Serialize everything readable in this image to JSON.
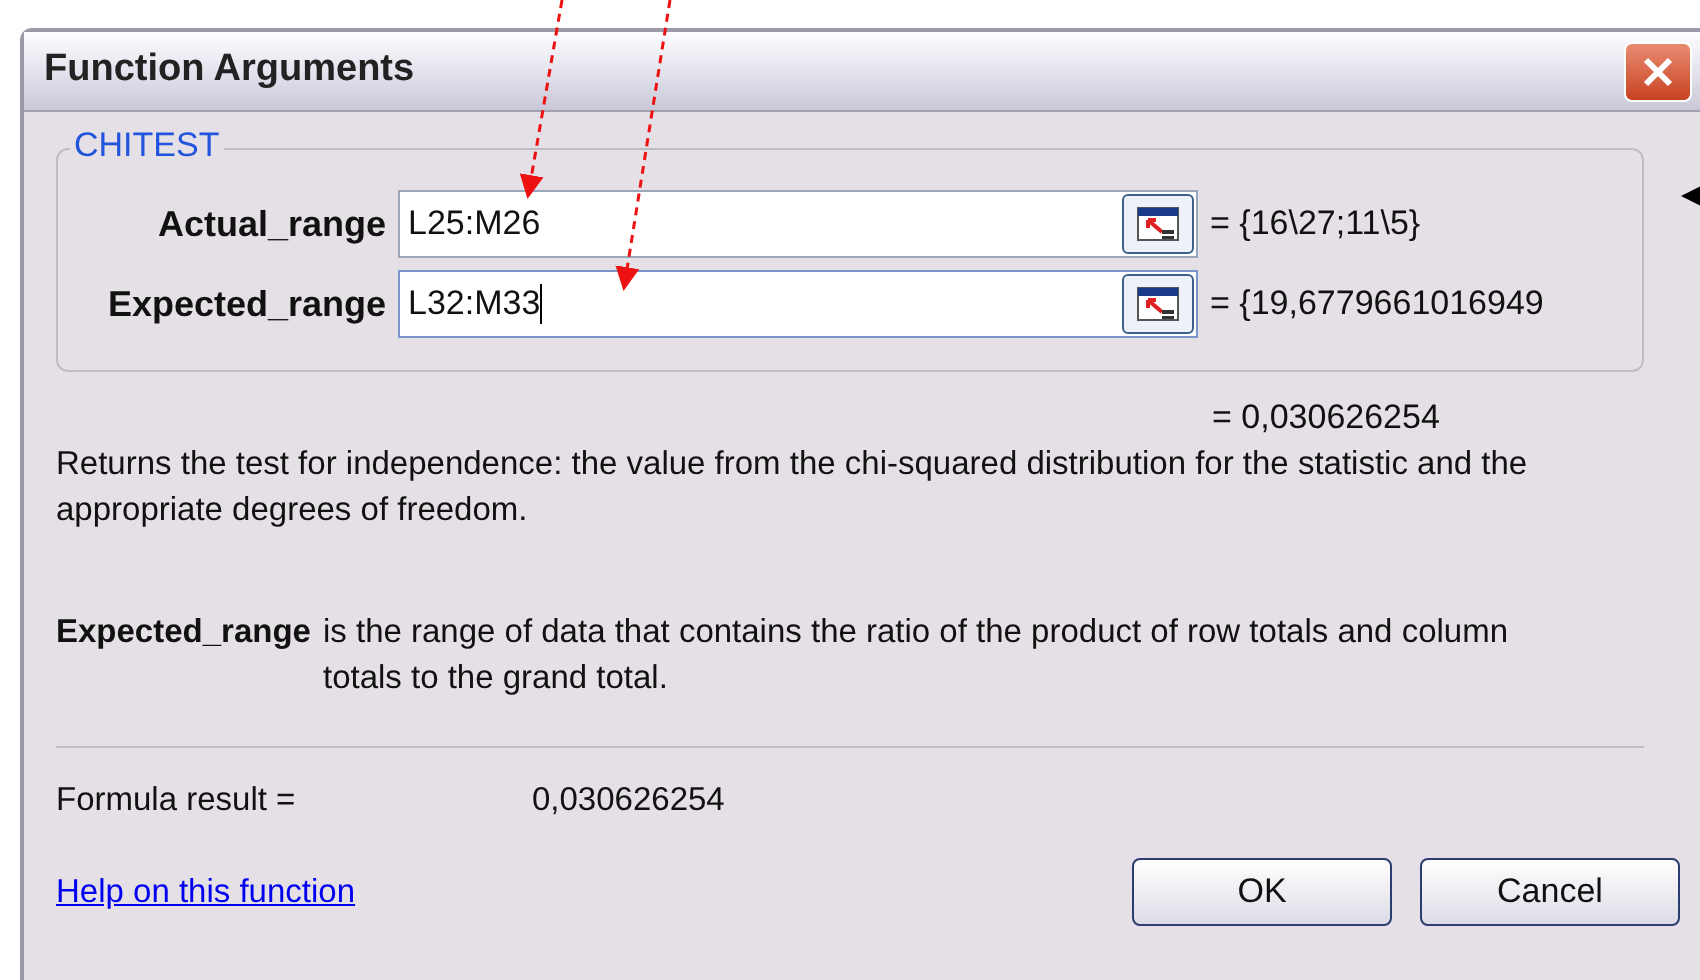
{
  "window": {
    "title": "Function Arguments"
  },
  "function_group": {
    "name": "CHITEST",
    "arguments": [
      {
        "label": "Actual_range",
        "value": "L25:M26",
        "focused": false,
        "result": "= {16\\27;11\\5}"
      },
      {
        "label": "Expected_range",
        "value": "L32:M33",
        "focused": true,
        "result": "= {19,6779661016949"
      }
    ]
  },
  "function_result": "= 0,030626254",
  "description": "Returns the test for independence: the value from the chi-squared distribution for the statistic and the appropriate degrees of freedom.",
  "argument_help": {
    "name": "Expected_range",
    "text": "is the range of data that contains the ratio of the product of row totals and column totals to the grand total."
  },
  "formula_result": {
    "label": "Formula result =",
    "value": "0,030626254"
  },
  "help_link": "Help on this function",
  "buttons": [
    "OK",
    "Cancel"
  ]
}
